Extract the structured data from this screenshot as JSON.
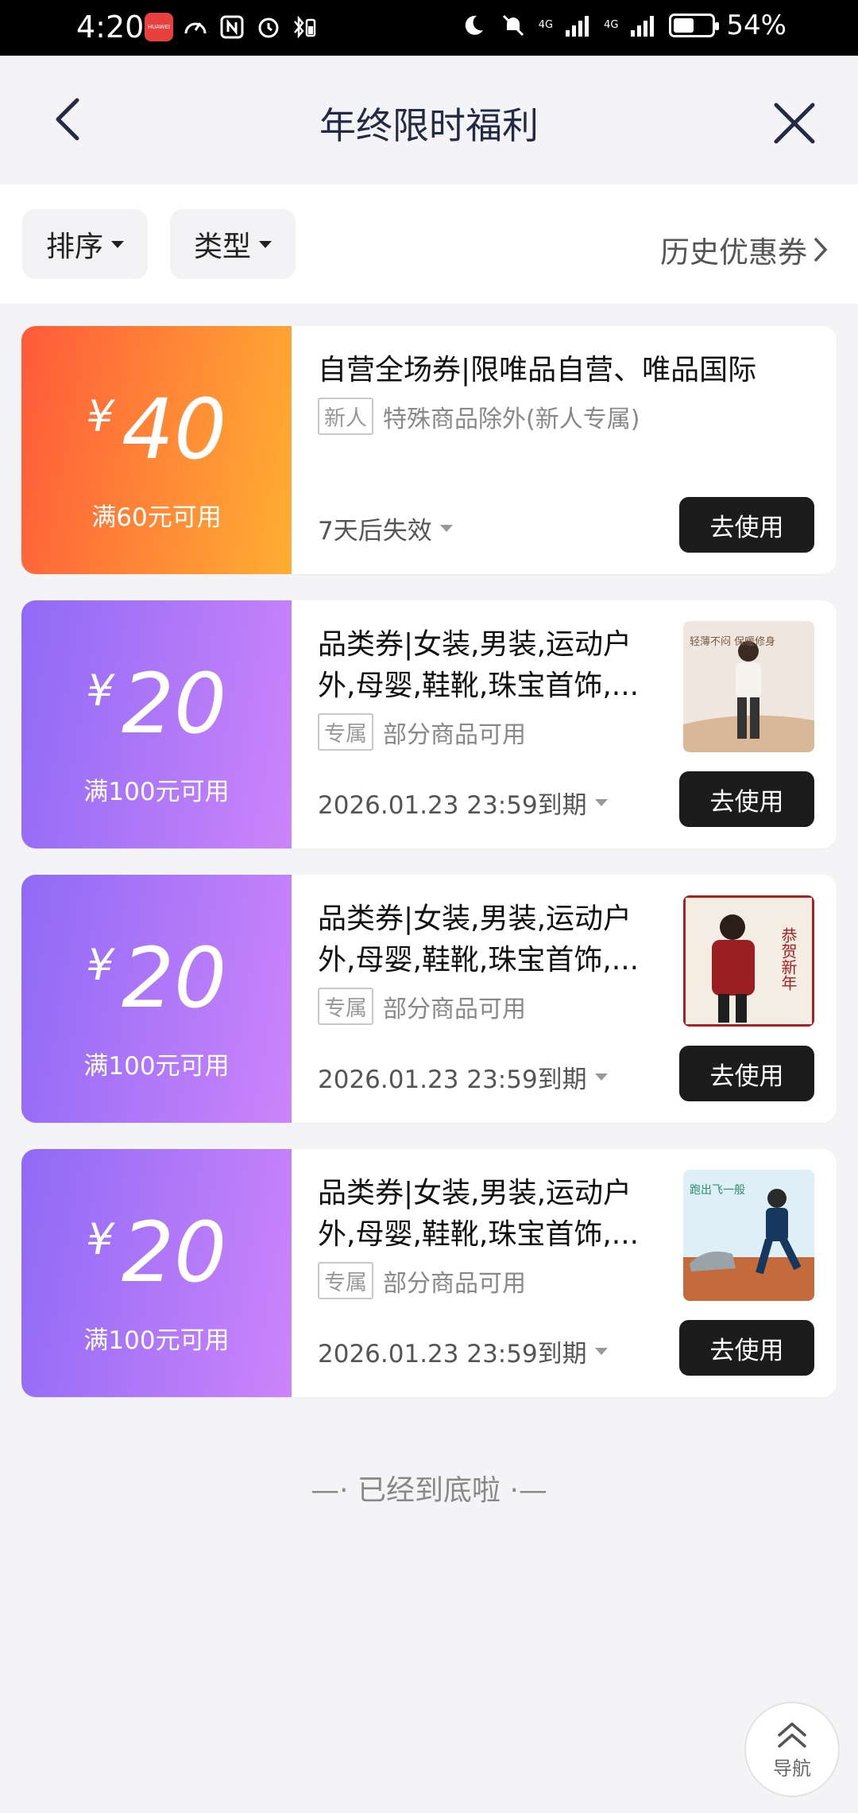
{
  "status_bar": {
    "time": "4:20",
    "network_1": "4G",
    "network_2": "4G",
    "battery": "54%",
    "battery_level": 0.54
  },
  "header": {
    "title": "年终限时福利"
  },
  "filters": {
    "sort_label": "排序",
    "type_label": "类型",
    "history_label": "历史优惠券"
  },
  "coupons": [
    {
      "currency": "¥",
      "amount": "40",
      "condition": "满60元可用",
      "title": "自营全场券|限唯品自营、唯品国际",
      "tag": "新人",
      "description": "特殊商品除外(新人专属)",
      "expiry": "7天后失效",
      "button": "去使用",
      "style": "orange"
    },
    {
      "currency": "¥",
      "amount": "20",
      "condition": "满100元可用",
      "title": "品类券|女装,男装,运动户外,母婴,鞋靴,珠宝首饰,...",
      "tag": "专属",
      "description": "部分商品可用",
      "expiry": "2026.01.23 23:59到期",
      "button": "去使用",
      "style": "purple",
      "thumb_text": "轻薄不闷 保暖修身"
    },
    {
      "currency": "¥",
      "amount": "20",
      "condition": "满100元可用",
      "title": "品类券|女装,男装,运动户外,母婴,鞋靴,珠宝首饰,...",
      "tag": "专属",
      "description": "部分商品可用",
      "expiry": "2026.01.23 23:59到期",
      "button": "去使用",
      "style": "purple",
      "thumb_text": "恭贺新年"
    },
    {
      "currency": "¥",
      "amount": "20",
      "condition": "满100元可用",
      "title": "品类券|女装,男装,运动户外,母婴,鞋靴,珠宝首饰,...",
      "tag": "专属",
      "description": "部分商品可用",
      "expiry": "2026.01.23 23:59到期",
      "button": "去使用",
      "style": "purple",
      "thumb_text": "跑出飞一般"
    }
  ],
  "end_of_list": "—· 已经到底啦 ·—",
  "float_nav": {
    "label": "导航"
  },
  "colors": {
    "accent_orange": "#ff8a36",
    "accent_purple": "#b47af8",
    "button_dark": "#1c1c1c",
    "title_navy": "#232a44"
  }
}
